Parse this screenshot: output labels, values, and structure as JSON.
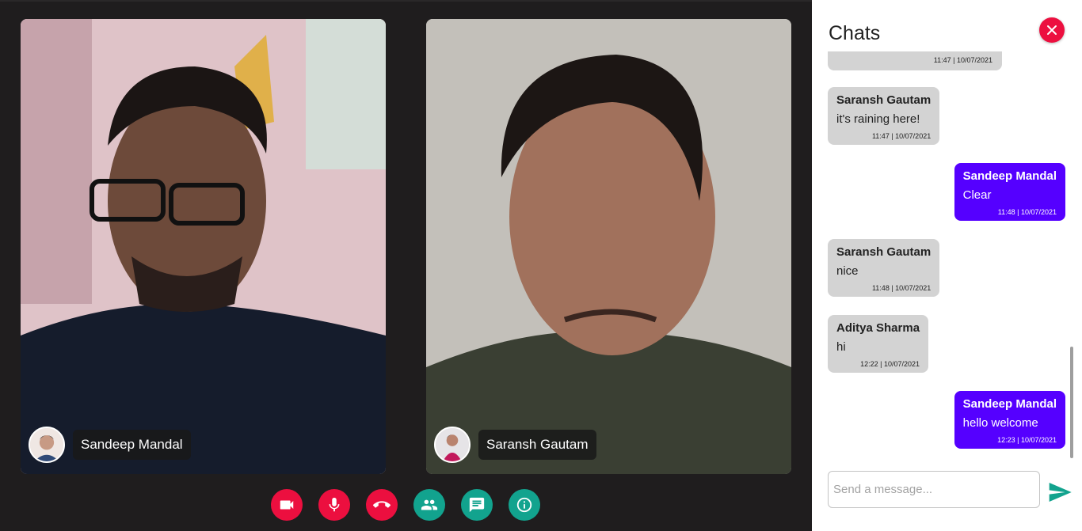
{
  "participants": [
    {
      "name": "Sandeep Mandal",
      "avatar_icon": "user-avatar"
    },
    {
      "name": "Saransh Gautam",
      "avatar_icon": "user-avatar"
    }
  ],
  "controls": [
    {
      "name": "camera-button",
      "icon": "videocam-icon",
      "color": "#ec0f3f"
    },
    {
      "name": "mic-button",
      "icon": "mic-icon",
      "color": "#ec0f3f"
    },
    {
      "name": "end-call-button",
      "icon": "call-end-icon",
      "color": "#ec0f3f"
    },
    {
      "name": "participants-button",
      "icon": "people-icon",
      "color": "#12a38e"
    },
    {
      "name": "chat-button",
      "icon": "chat-icon",
      "color": "#12a38e"
    },
    {
      "name": "info-button",
      "icon": "info-icon",
      "color": "#12a38e"
    }
  ],
  "chat": {
    "title": "Chats",
    "close_icon": "close-icon",
    "previous_time": "11:47 | 10/07/2021",
    "messages": [
      {
        "sender": "Saransh Gautam",
        "text": "it's raining here!",
        "time": "11:47 | 10/07/2021",
        "own": false
      },
      {
        "sender": "Sandeep Mandal",
        "text": "Clear",
        "time": "11:48 | 10/07/2021",
        "own": true
      },
      {
        "sender": "Saransh Gautam",
        "text": "nice",
        "time": "11:48 | 10/07/2021",
        "own": false
      },
      {
        "sender": "Aditya Sharma",
        "text": "hi",
        "time": "12:22 | 10/07/2021",
        "own": false
      },
      {
        "sender": "Sandeep Mandal",
        "text": "hello welcome",
        "time": "12:23 | 10/07/2021",
        "own": true
      }
    ],
    "input_placeholder": "Send a message...",
    "input_value": "",
    "send_icon": "send-icon"
  },
  "colors": {
    "accent_red": "#ec0f3f",
    "accent_teal": "#12a38e",
    "own_message": "#5500ff",
    "other_message": "#d3d3d3"
  }
}
